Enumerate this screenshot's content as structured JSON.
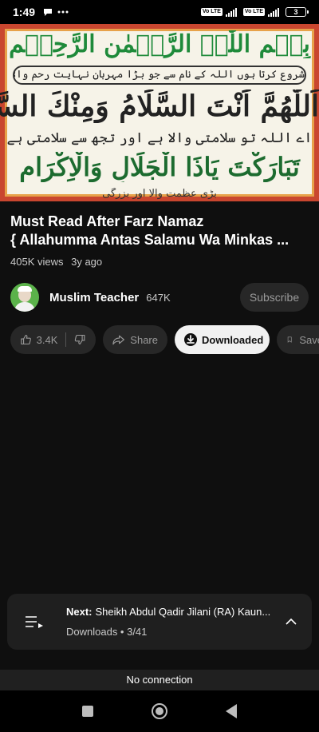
{
  "status_bar": {
    "time": "1:49",
    "sim1": "Vo LTE",
    "sim2": "Vo LTE",
    "battery": "3"
  },
  "thumbnail": {
    "line1": "بِسۡمِ اللّٰہِ الرَّحۡمٰنِ الرَّحِیۡمِ",
    "line2": "شروع کرتا ہوں اللہ کے نام سے جو بڑا مہربان نہایت رحم والا ہے",
    "line3": "اَللّٰھُمَّ اَنْتَ السَّلَامُ وَمِنْكَ السَّلَامُ",
    "line4": "اے اللہ تو سلامتی والا ہے اور تجھ سے سلامتی ہے",
    "line5": "تَبَارَكْتَ يَاذَا الْجَلَالِ وَالْاِكْرَامِ",
    "line6": "بڑی عظمت والا اور بزرگی"
  },
  "video": {
    "title_line1": "Must Read After Farz Namaz",
    "title_line2": "{ Allahumma Antas Salamu Wa Minkas ...",
    "views": "405K views",
    "age": "3y ago"
  },
  "channel": {
    "name": "Muslim Teacher",
    "subscribers": "647K",
    "subscribe_label": "Subscribe"
  },
  "actions": {
    "like_count": "3.4K",
    "share_label": "Share",
    "downloaded_label": "Downloaded",
    "save_label": "Save"
  },
  "up_next": {
    "prefix": "Next:",
    "title": "Sheikh Abdul Qadir Jilani (RA) Kaun...",
    "playlist": "Downloads • 3/41"
  },
  "banner": {
    "no_connection": "No connection"
  }
}
